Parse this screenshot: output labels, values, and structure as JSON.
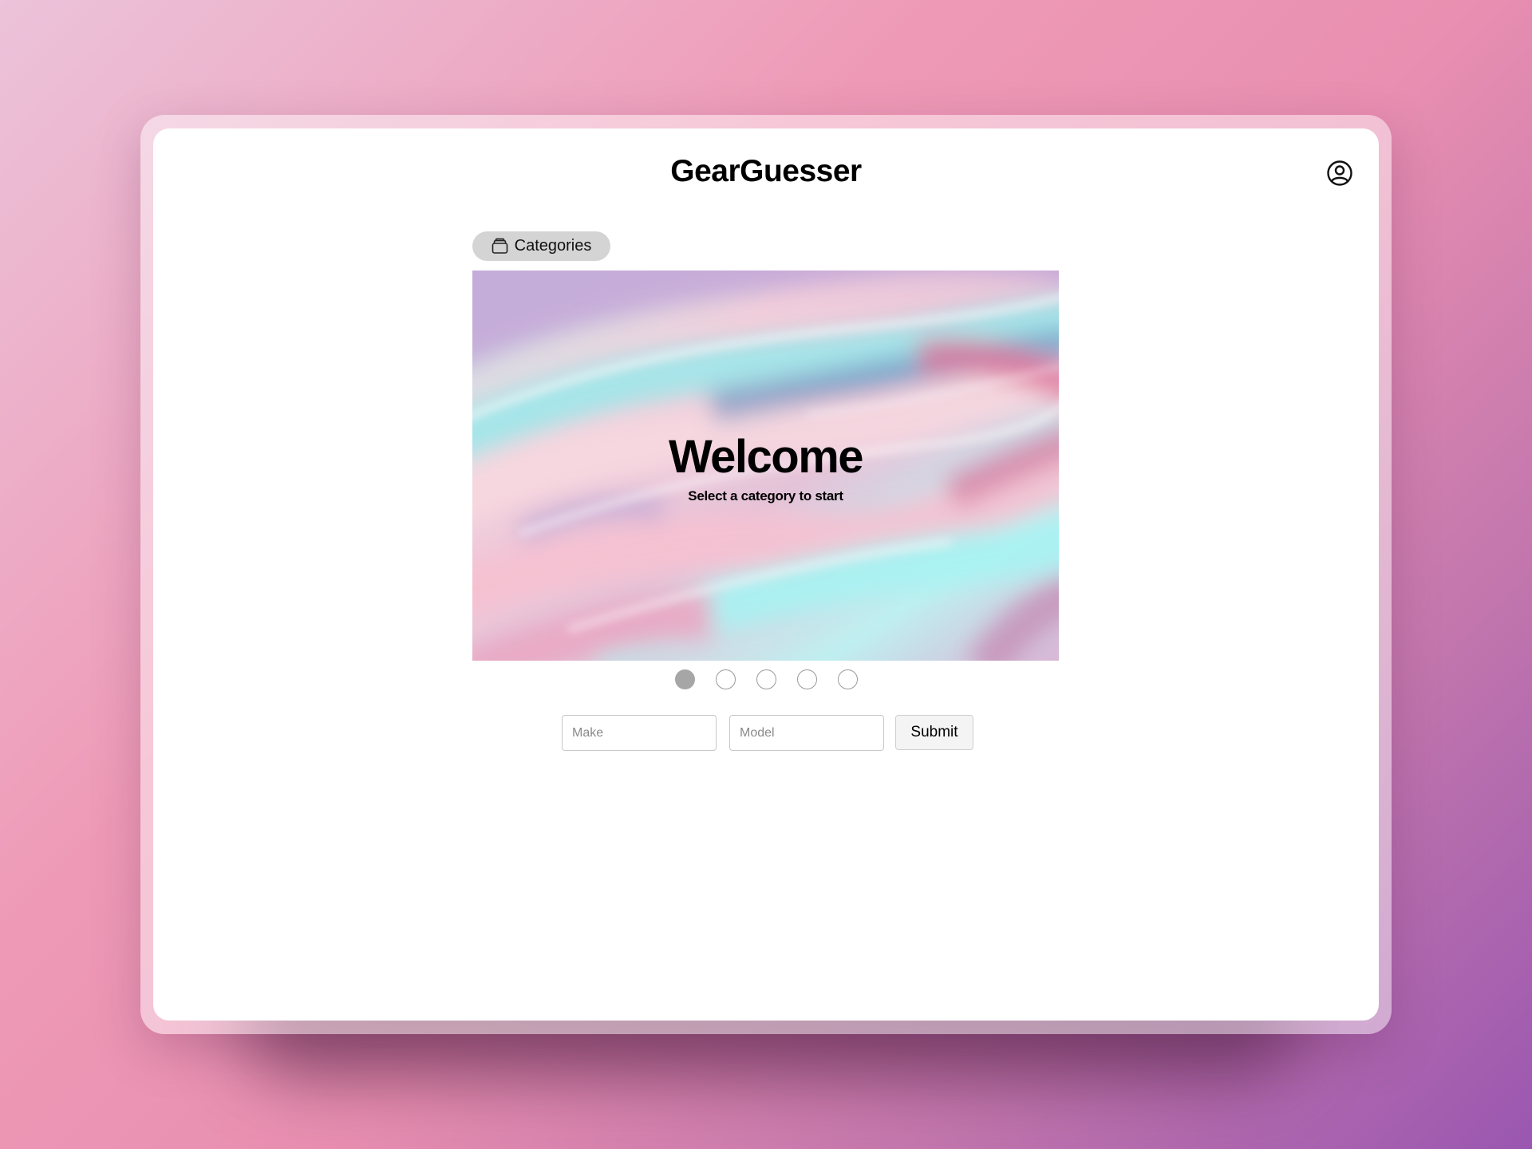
{
  "app": {
    "title": "GearGuesser"
  },
  "header": {
    "profile_icon": "user-circle-icon"
  },
  "categories": {
    "label": "Categories",
    "icon": "card-stack-icon"
  },
  "hero": {
    "title": "Welcome",
    "subtitle": "Select a category to start",
    "background": "iridescent-holographic-waves"
  },
  "pagination": {
    "total": 5,
    "active_index": 0
  },
  "form": {
    "make_placeholder": "Make",
    "make_value": "",
    "model_placeholder": "Model",
    "model_value": "",
    "submit_label": "Submit"
  },
  "colors": {
    "background_start": "#ecc3da",
    "background_end": "#9a57b0",
    "active_dot": "#a6a6a6",
    "categories_pill": "#d4d4d4"
  }
}
